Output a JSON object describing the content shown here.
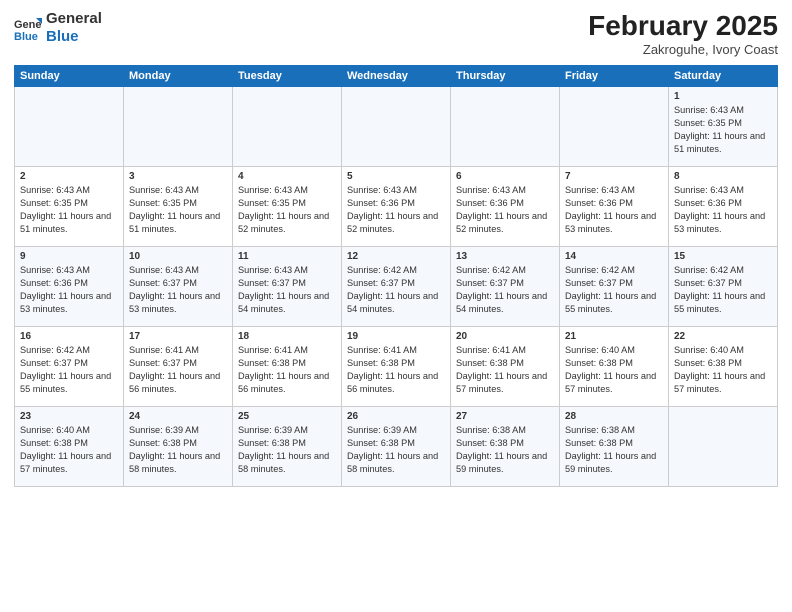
{
  "header": {
    "logo_general": "General",
    "logo_blue": "Blue",
    "main_title": "February 2025",
    "subtitle": "Zakroguhe, Ivory Coast"
  },
  "days_of_week": [
    "Sunday",
    "Monday",
    "Tuesday",
    "Wednesday",
    "Thursday",
    "Friday",
    "Saturday"
  ],
  "weeks": [
    [
      {
        "day": "",
        "info": ""
      },
      {
        "day": "",
        "info": ""
      },
      {
        "day": "",
        "info": ""
      },
      {
        "day": "",
        "info": ""
      },
      {
        "day": "",
        "info": ""
      },
      {
        "day": "",
        "info": ""
      },
      {
        "day": "1",
        "info": "Sunrise: 6:43 AM\nSunset: 6:35 PM\nDaylight: 11 hours and 51 minutes."
      }
    ],
    [
      {
        "day": "2",
        "info": "Sunrise: 6:43 AM\nSunset: 6:35 PM\nDaylight: 11 hours and 51 minutes."
      },
      {
        "day": "3",
        "info": "Sunrise: 6:43 AM\nSunset: 6:35 PM\nDaylight: 11 hours and 51 minutes."
      },
      {
        "day": "4",
        "info": "Sunrise: 6:43 AM\nSunset: 6:35 PM\nDaylight: 11 hours and 52 minutes."
      },
      {
        "day": "5",
        "info": "Sunrise: 6:43 AM\nSunset: 6:36 PM\nDaylight: 11 hours and 52 minutes."
      },
      {
        "day": "6",
        "info": "Sunrise: 6:43 AM\nSunset: 6:36 PM\nDaylight: 11 hours and 52 minutes."
      },
      {
        "day": "7",
        "info": "Sunrise: 6:43 AM\nSunset: 6:36 PM\nDaylight: 11 hours and 53 minutes."
      },
      {
        "day": "8",
        "info": "Sunrise: 6:43 AM\nSunset: 6:36 PM\nDaylight: 11 hours and 53 minutes."
      }
    ],
    [
      {
        "day": "9",
        "info": "Sunrise: 6:43 AM\nSunset: 6:36 PM\nDaylight: 11 hours and 53 minutes."
      },
      {
        "day": "10",
        "info": "Sunrise: 6:43 AM\nSunset: 6:37 PM\nDaylight: 11 hours and 53 minutes."
      },
      {
        "day": "11",
        "info": "Sunrise: 6:43 AM\nSunset: 6:37 PM\nDaylight: 11 hours and 54 minutes."
      },
      {
        "day": "12",
        "info": "Sunrise: 6:42 AM\nSunset: 6:37 PM\nDaylight: 11 hours and 54 minutes."
      },
      {
        "day": "13",
        "info": "Sunrise: 6:42 AM\nSunset: 6:37 PM\nDaylight: 11 hours and 54 minutes."
      },
      {
        "day": "14",
        "info": "Sunrise: 6:42 AM\nSunset: 6:37 PM\nDaylight: 11 hours and 55 minutes."
      },
      {
        "day": "15",
        "info": "Sunrise: 6:42 AM\nSunset: 6:37 PM\nDaylight: 11 hours and 55 minutes."
      }
    ],
    [
      {
        "day": "16",
        "info": "Sunrise: 6:42 AM\nSunset: 6:37 PM\nDaylight: 11 hours and 55 minutes."
      },
      {
        "day": "17",
        "info": "Sunrise: 6:41 AM\nSunset: 6:37 PM\nDaylight: 11 hours and 56 minutes."
      },
      {
        "day": "18",
        "info": "Sunrise: 6:41 AM\nSunset: 6:38 PM\nDaylight: 11 hours and 56 minutes."
      },
      {
        "day": "19",
        "info": "Sunrise: 6:41 AM\nSunset: 6:38 PM\nDaylight: 11 hours and 56 minutes."
      },
      {
        "day": "20",
        "info": "Sunrise: 6:41 AM\nSunset: 6:38 PM\nDaylight: 11 hours and 57 minutes."
      },
      {
        "day": "21",
        "info": "Sunrise: 6:40 AM\nSunset: 6:38 PM\nDaylight: 11 hours and 57 minutes."
      },
      {
        "day": "22",
        "info": "Sunrise: 6:40 AM\nSunset: 6:38 PM\nDaylight: 11 hours and 57 minutes."
      }
    ],
    [
      {
        "day": "23",
        "info": "Sunrise: 6:40 AM\nSunset: 6:38 PM\nDaylight: 11 hours and 57 minutes."
      },
      {
        "day": "24",
        "info": "Sunrise: 6:39 AM\nSunset: 6:38 PM\nDaylight: 11 hours and 58 minutes."
      },
      {
        "day": "25",
        "info": "Sunrise: 6:39 AM\nSunset: 6:38 PM\nDaylight: 11 hours and 58 minutes."
      },
      {
        "day": "26",
        "info": "Sunrise: 6:39 AM\nSunset: 6:38 PM\nDaylight: 11 hours and 58 minutes."
      },
      {
        "day": "27",
        "info": "Sunrise: 6:38 AM\nSunset: 6:38 PM\nDaylight: 11 hours and 59 minutes."
      },
      {
        "day": "28",
        "info": "Sunrise: 6:38 AM\nSunset: 6:38 PM\nDaylight: 11 hours and 59 minutes."
      },
      {
        "day": "",
        "info": ""
      }
    ]
  ]
}
